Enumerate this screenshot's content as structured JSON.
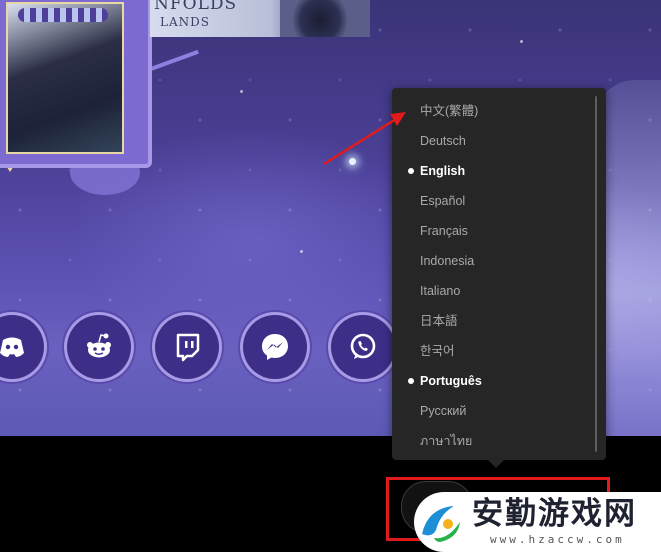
{
  "background": {
    "banner_line1": "NFOLDS",
    "banner_line2": "LANDS"
  },
  "social_icons": [
    {
      "name": "discord-icon"
    },
    {
      "name": "reddit-icon"
    },
    {
      "name": "twitch-icon"
    },
    {
      "name": "messenger-icon"
    },
    {
      "name": "whatsapp-icon"
    }
  ],
  "language_menu": {
    "items": [
      {
        "label": "中文(繁體)",
        "selected": false
      },
      {
        "label": "Deutsch",
        "selected": false
      },
      {
        "label": "English",
        "selected": true
      },
      {
        "label": "Español",
        "selected": false
      },
      {
        "label": "Français",
        "selected": false
      },
      {
        "label": "Indonesia",
        "selected": false
      },
      {
        "label": "Italiano",
        "selected": false
      },
      {
        "label": "日本語",
        "selected": false
      },
      {
        "label": "한국어",
        "selected": false
      },
      {
        "label": "Português",
        "selected": true
      },
      {
        "label": "Русский",
        "selected": false
      },
      {
        "label": "ภาษาไทย",
        "selected": false
      }
    ]
  },
  "watermark": {
    "title": "安勤游戏网",
    "url": "www.hzaccw.com"
  },
  "colors": {
    "annotation_red": "#e11b1b",
    "menu_bg": "#262626",
    "icon_bg": "#3d2e88"
  }
}
